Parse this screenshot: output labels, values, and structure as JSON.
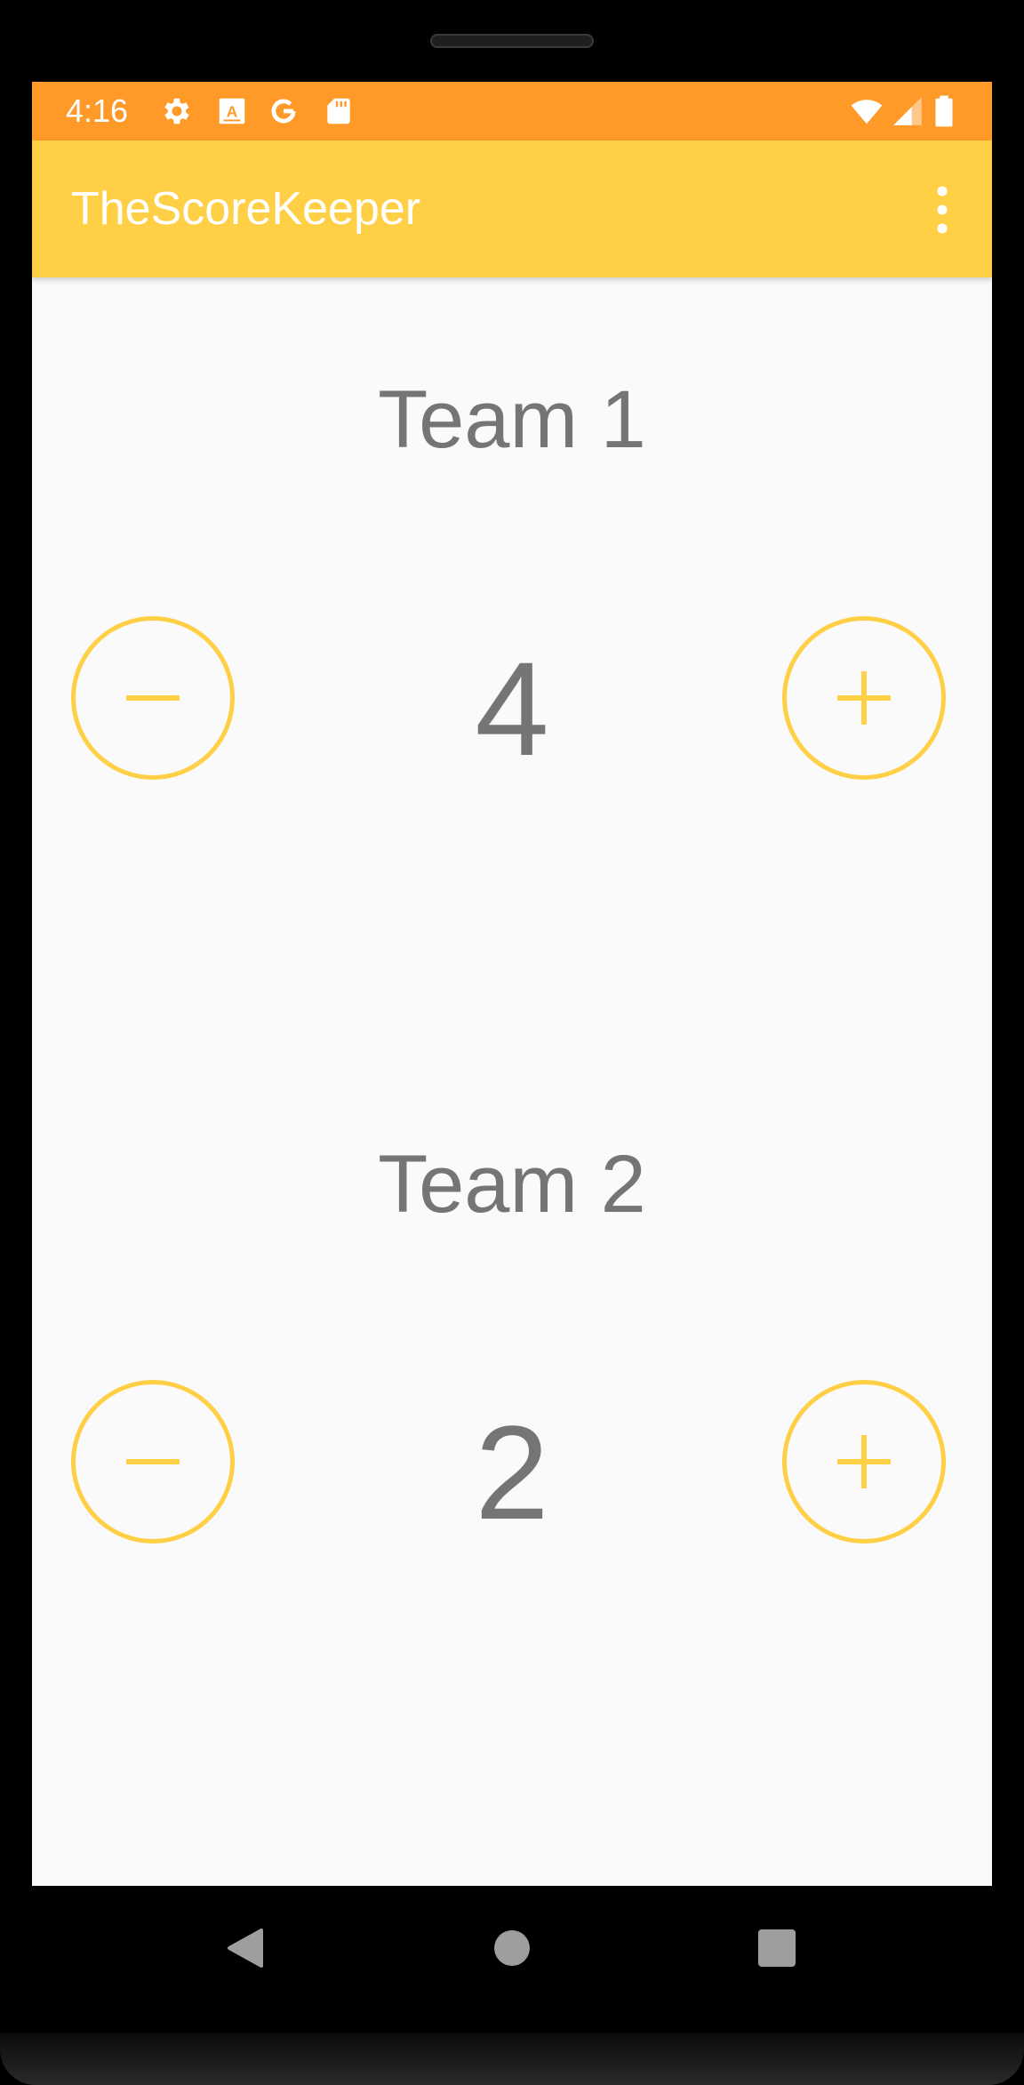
{
  "status_bar": {
    "time": "4:16",
    "left_icons": [
      "gear-icon",
      "font-a-icon",
      "google-g-icon",
      "sd-card-icon"
    ],
    "right_icons": [
      "wifi-icon",
      "cell-signal-icon",
      "battery-icon"
    ],
    "color": "#ff9a28"
  },
  "app_bar": {
    "title": "TheScoreKeeper",
    "menu_icon": "more-vert-icon",
    "color": "#ffd046"
  },
  "teams": [
    {
      "name": "Team 1",
      "score": "4"
    },
    {
      "name": "Team 2",
      "score": "2"
    }
  ],
  "buttons": {
    "decrement_icon": "minus-icon",
    "increment_icon": "plus-icon",
    "accent": "#ffd046"
  },
  "text_color": "#757575",
  "nav_bar": {
    "icons": [
      "back-triangle-icon",
      "home-circle-icon",
      "recents-square-icon"
    ]
  }
}
